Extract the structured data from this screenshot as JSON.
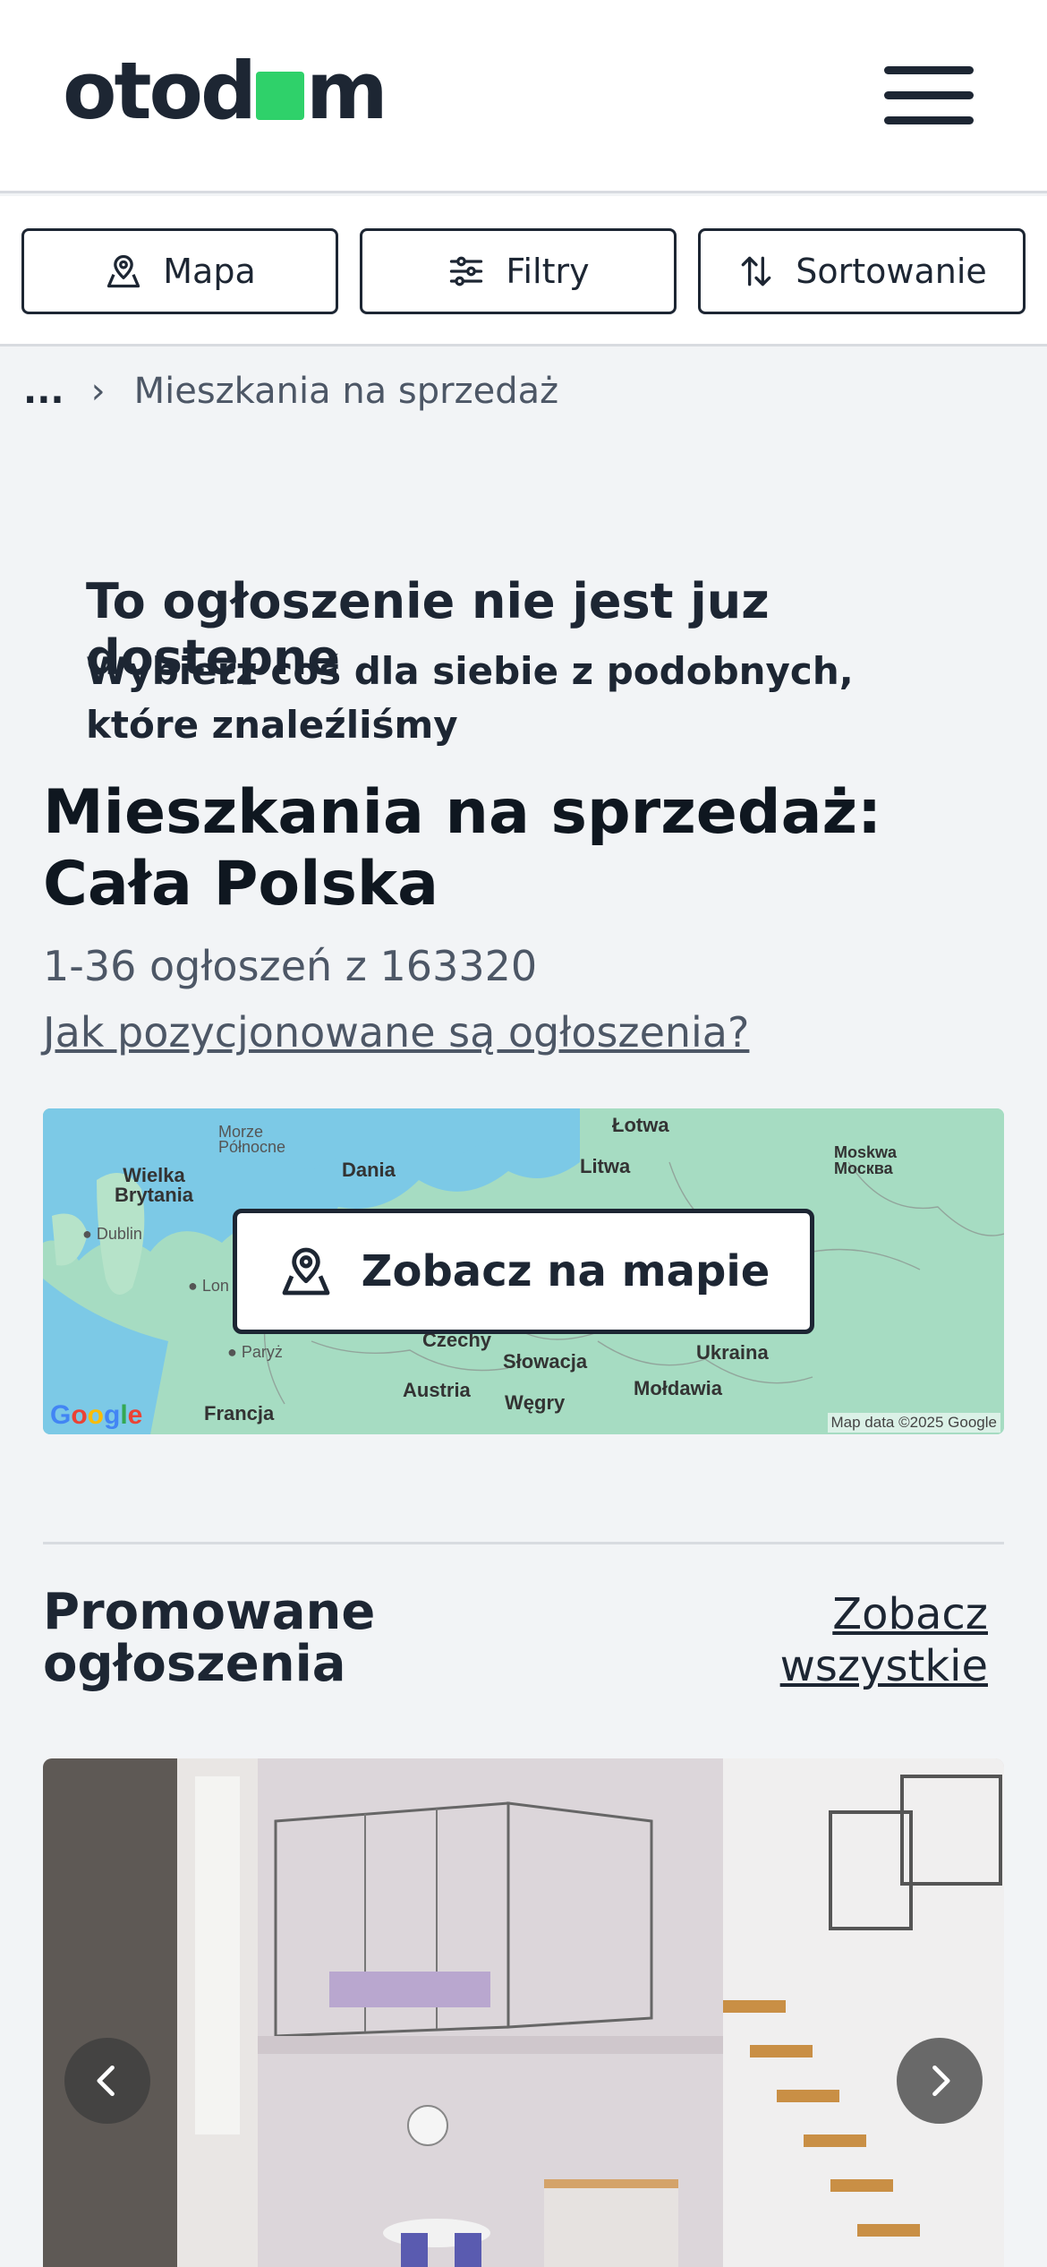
{
  "header": {
    "logo_pre": "otod",
    "logo_post": "m",
    "menu_icon": "hamburger-menu-icon"
  },
  "toolbar": {
    "map_label": "Mapa",
    "filters_label": "Filtry",
    "sort_label": "Sortowanie"
  },
  "breadcrumb": {
    "ellipsis": "...",
    "separator": "›",
    "current": "Mieszkania na sprzedaż"
  },
  "notice": {
    "title": "To ogłoszenie nie jest juz dostępne",
    "subtitle": "Wybierz coś dla siebie z podobnych, które znaleźliśmy"
  },
  "listing": {
    "heading": "Mieszkania na sprzedaż: Cała Polska",
    "count": "1-36 ogłoszeń z 163320",
    "ranking_link": "Jak pozycjonowane są ogłoszenia?"
  },
  "map": {
    "button_label": "Zobacz na mapie",
    "attribution": "Map data ©2025 Google",
    "google": "Google",
    "labels": {
      "morze": "Morze\nPółnocne",
      "wielka_brytania": "Wielka\nBrytania",
      "dublin": "Dublin",
      "londyn": "Lon",
      "dania": "Dania",
      "litwa": "Litwa",
      "lotwa": "Łotwa",
      "moskwa": "Moskwa\nМосква",
      "paryz": "Paryż",
      "francja": "Francja",
      "czechy": "Czechy",
      "slowacja": "Słowacja",
      "austria": "Austria",
      "wegry": "Węgry",
      "ukraina": "Ukraina",
      "moldawia": "Mołdawia"
    }
  },
  "promoted": {
    "title": "Promowane ogłoszenia",
    "see_all": "Zobacz wszystkie"
  },
  "colors": {
    "brand_green": "#2fd16a",
    "text_dark": "#1d2633",
    "page_bg": "#f2f4f6"
  }
}
